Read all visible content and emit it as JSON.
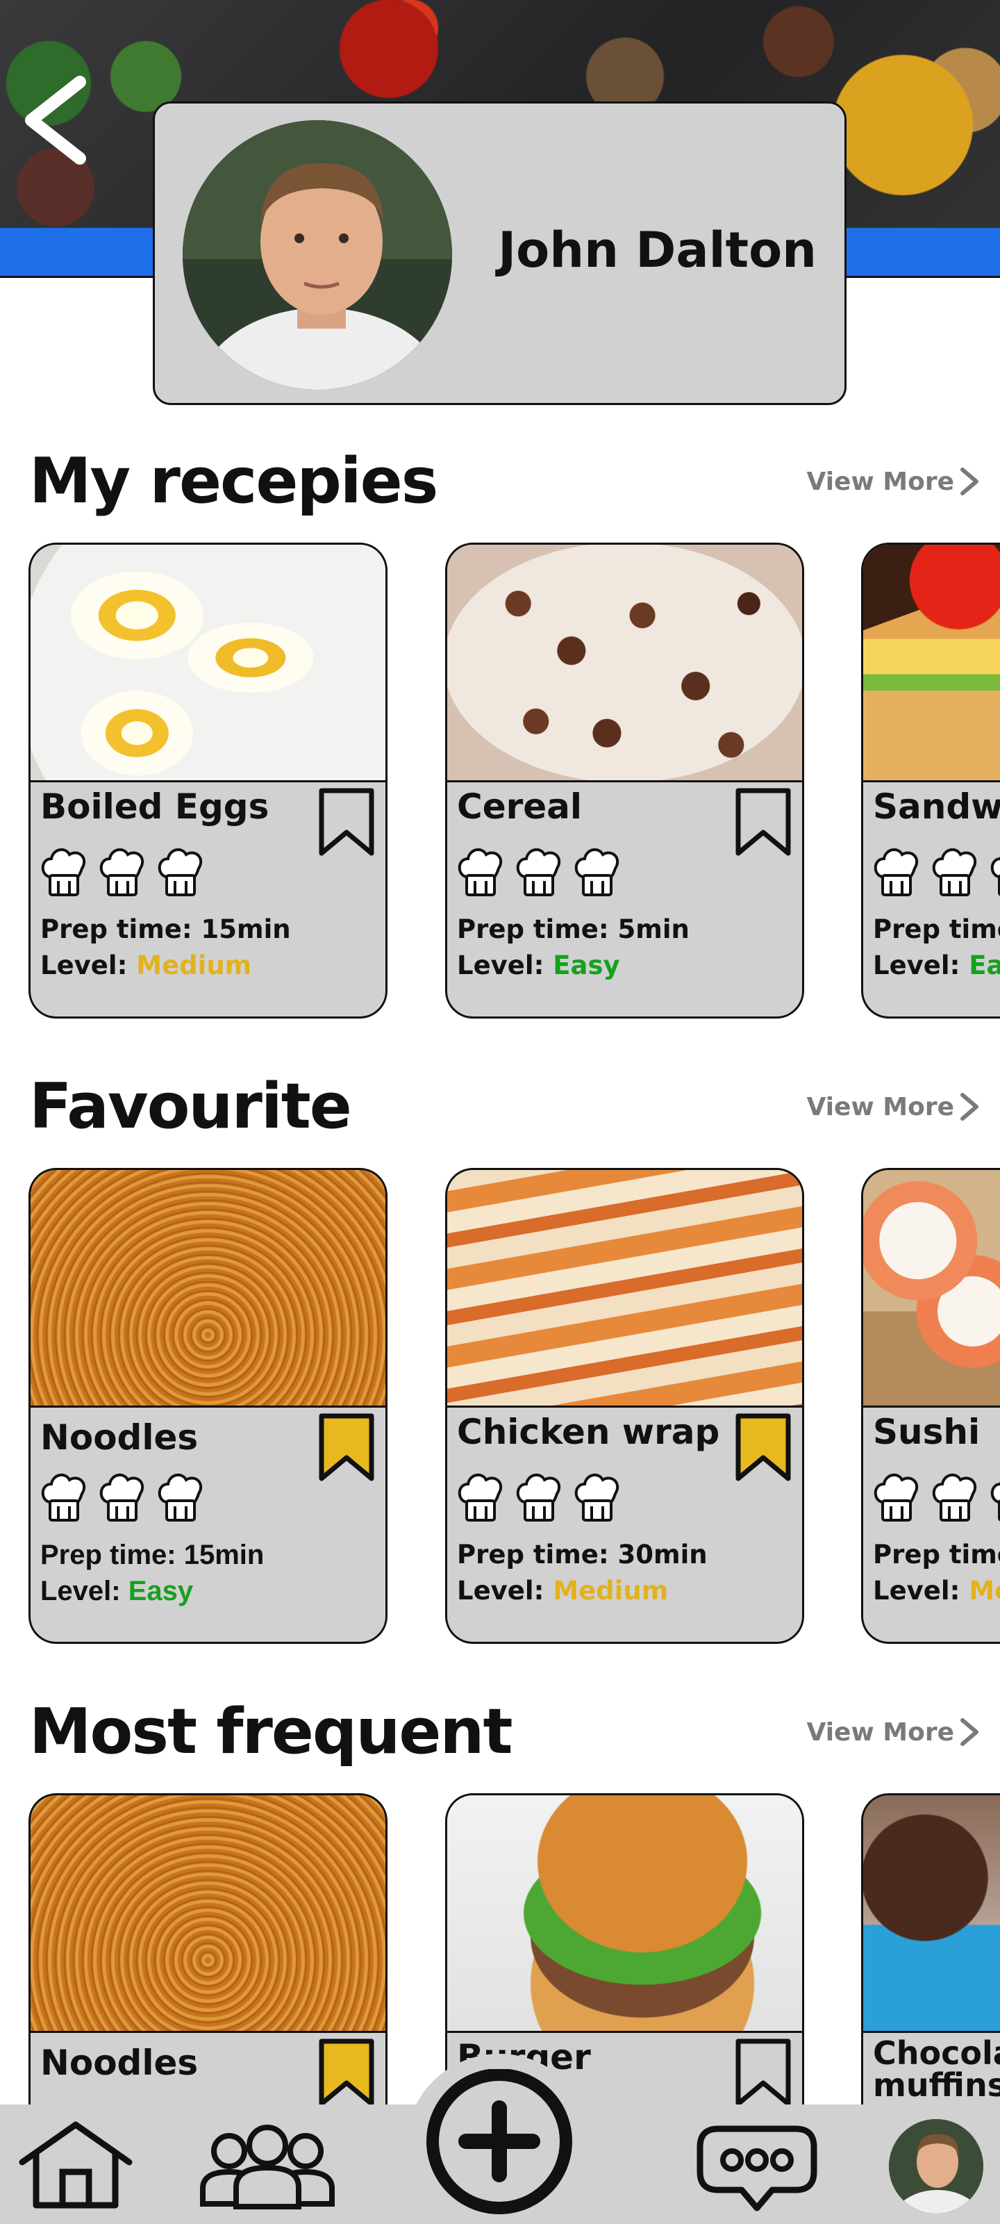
{
  "profile": {
    "name": "John Dalton"
  },
  "sections": {
    "my_recipes": {
      "title": "My recepies",
      "view_more": "View More",
      "cards": [
        {
          "title": "Boiled Eggs",
          "prep": "Prep time: 15min",
          "level_label": "Level: ",
          "level": "Medium",
          "bookmarked": false
        },
        {
          "title": "Cereal",
          "prep": "Prep time: 5min",
          "level_label": "Level: ",
          "level": "Easy",
          "bookmarked": false
        },
        {
          "title": "Sandwich",
          "prep": "Prep time",
          "level_label": "Level: ",
          "level": "Eas",
          "bookmarked": false
        }
      ]
    },
    "favourite": {
      "title": "Favourite",
      "view_more": "View More",
      "cards": [
        {
          "title": "Noodles",
          "prep": "Prep time: 15min",
          "level_label": "Level: ",
          "level": "Easy",
          "bookmarked": true
        },
        {
          "title": "Chicken wrap",
          "prep": "Prep time: 30min",
          "level_label": "Level: ",
          "level": "Medium",
          "bookmarked": true
        },
        {
          "title": "Sushi",
          "prep": "Prep time",
          "level_label": "Level: ",
          "level": "Me",
          "bookmarked": false
        }
      ]
    },
    "most_frequent": {
      "title": "Most frequent",
      "view_more": "View More",
      "cards": [
        {
          "title": "Noodles",
          "bookmarked": true
        },
        {
          "title": "Burger",
          "bookmarked": false
        },
        {
          "title": "Chocolate muffins",
          "bookmarked": false
        }
      ]
    }
  },
  "colors": {
    "accent_blue": "#1e6fe8",
    "card_gray": "#d1d1d1",
    "medium": "#e2b21e",
    "easy": "#17a01e",
    "bookmark_gold": "#e7b91f"
  },
  "icons": {
    "nav": [
      "home-icon",
      "community-icon",
      "add-icon",
      "chat-icon",
      "profile-avatar"
    ],
    "card": [
      "chef-hat-icon",
      "bookmark-icon"
    ],
    "header": [
      "back-icon"
    ]
  }
}
